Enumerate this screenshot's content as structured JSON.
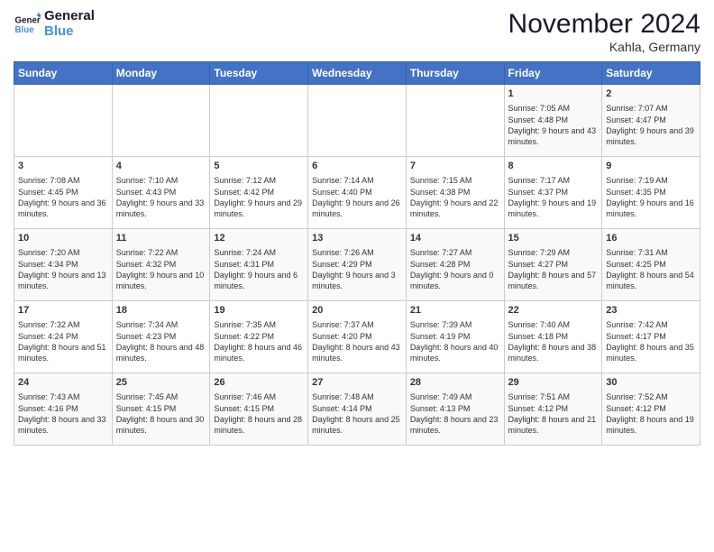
{
  "logo": {
    "name_part1": "General",
    "name_part2": "Blue"
  },
  "header": {
    "month": "November 2024",
    "location": "Kahla, Germany"
  },
  "weekdays": [
    "Sunday",
    "Monday",
    "Tuesday",
    "Wednesday",
    "Thursday",
    "Friday",
    "Saturday"
  ],
  "weeks": [
    [
      {
        "day": "",
        "info": ""
      },
      {
        "day": "",
        "info": ""
      },
      {
        "day": "",
        "info": ""
      },
      {
        "day": "",
        "info": ""
      },
      {
        "day": "",
        "info": ""
      },
      {
        "day": "1",
        "info": "Sunrise: 7:05 AM\nSunset: 4:48 PM\nDaylight: 9 hours and 43 minutes."
      },
      {
        "day": "2",
        "info": "Sunrise: 7:07 AM\nSunset: 4:47 PM\nDaylight: 9 hours and 39 minutes."
      }
    ],
    [
      {
        "day": "3",
        "info": "Sunrise: 7:08 AM\nSunset: 4:45 PM\nDaylight: 9 hours and 36 minutes."
      },
      {
        "day": "4",
        "info": "Sunrise: 7:10 AM\nSunset: 4:43 PM\nDaylight: 9 hours and 33 minutes."
      },
      {
        "day": "5",
        "info": "Sunrise: 7:12 AM\nSunset: 4:42 PM\nDaylight: 9 hours and 29 minutes."
      },
      {
        "day": "6",
        "info": "Sunrise: 7:14 AM\nSunset: 4:40 PM\nDaylight: 9 hours and 26 minutes."
      },
      {
        "day": "7",
        "info": "Sunrise: 7:15 AM\nSunset: 4:38 PM\nDaylight: 9 hours and 22 minutes."
      },
      {
        "day": "8",
        "info": "Sunrise: 7:17 AM\nSunset: 4:37 PM\nDaylight: 9 hours and 19 minutes."
      },
      {
        "day": "9",
        "info": "Sunrise: 7:19 AM\nSunset: 4:35 PM\nDaylight: 9 hours and 16 minutes."
      }
    ],
    [
      {
        "day": "10",
        "info": "Sunrise: 7:20 AM\nSunset: 4:34 PM\nDaylight: 9 hours and 13 minutes."
      },
      {
        "day": "11",
        "info": "Sunrise: 7:22 AM\nSunset: 4:32 PM\nDaylight: 9 hours and 10 minutes."
      },
      {
        "day": "12",
        "info": "Sunrise: 7:24 AM\nSunset: 4:31 PM\nDaylight: 9 hours and 6 minutes."
      },
      {
        "day": "13",
        "info": "Sunrise: 7:26 AM\nSunset: 4:29 PM\nDaylight: 9 hours and 3 minutes."
      },
      {
        "day": "14",
        "info": "Sunrise: 7:27 AM\nSunset: 4:28 PM\nDaylight: 9 hours and 0 minutes."
      },
      {
        "day": "15",
        "info": "Sunrise: 7:29 AM\nSunset: 4:27 PM\nDaylight: 8 hours and 57 minutes."
      },
      {
        "day": "16",
        "info": "Sunrise: 7:31 AM\nSunset: 4:25 PM\nDaylight: 8 hours and 54 minutes."
      }
    ],
    [
      {
        "day": "17",
        "info": "Sunrise: 7:32 AM\nSunset: 4:24 PM\nDaylight: 8 hours and 51 minutes."
      },
      {
        "day": "18",
        "info": "Sunrise: 7:34 AM\nSunset: 4:23 PM\nDaylight: 8 hours and 48 minutes."
      },
      {
        "day": "19",
        "info": "Sunrise: 7:35 AM\nSunset: 4:22 PM\nDaylight: 8 hours and 46 minutes."
      },
      {
        "day": "20",
        "info": "Sunrise: 7:37 AM\nSunset: 4:20 PM\nDaylight: 8 hours and 43 minutes."
      },
      {
        "day": "21",
        "info": "Sunrise: 7:39 AM\nSunset: 4:19 PM\nDaylight: 8 hours and 40 minutes."
      },
      {
        "day": "22",
        "info": "Sunrise: 7:40 AM\nSunset: 4:18 PM\nDaylight: 8 hours and 38 minutes."
      },
      {
        "day": "23",
        "info": "Sunrise: 7:42 AM\nSunset: 4:17 PM\nDaylight: 8 hours and 35 minutes."
      }
    ],
    [
      {
        "day": "24",
        "info": "Sunrise: 7:43 AM\nSunset: 4:16 PM\nDaylight: 8 hours and 33 minutes."
      },
      {
        "day": "25",
        "info": "Sunrise: 7:45 AM\nSunset: 4:15 PM\nDaylight: 8 hours and 30 minutes."
      },
      {
        "day": "26",
        "info": "Sunrise: 7:46 AM\nSunset: 4:15 PM\nDaylight: 8 hours and 28 minutes."
      },
      {
        "day": "27",
        "info": "Sunrise: 7:48 AM\nSunset: 4:14 PM\nDaylight: 8 hours and 25 minutes."
      },
      {
        "day": "28",
        "info": "Sunrise: 7:49 AM\nSunset: 4:13 PM\nDaylight: 8 hours and 23 minutes."
      },
      {
        "day": "29",
        "info": "Sunrise: 7:51 AM\nSunset: 4:12 PM\nDaylight: 8 hours and 21 minutes."
      },
      {
        "day": "30",
        "info": "Sunrise: 7:52 AM\nSunset: 4:12 PM\nDaylight: 8 hours and 19 minutes."
      }
    ]
  ]
}
